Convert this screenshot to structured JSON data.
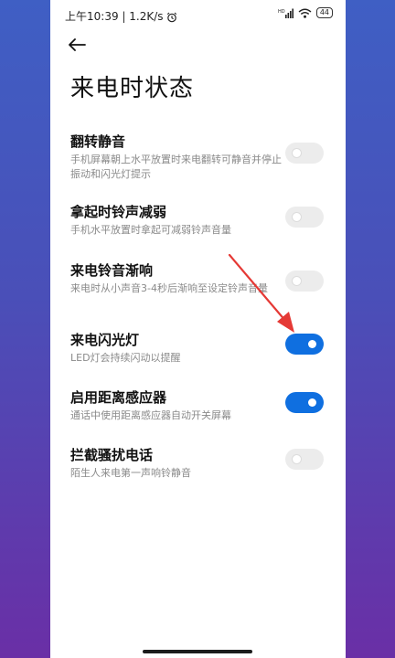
{
  "status_bar": {
    "time_speed": "上午10:39 | 1.2K/s",
    "signal_label": "HD",
    "battery": "44"
  },
  "page": {
    "title": "来电时状态"
  },
  "settings": [
    {
      "title": "翻转静音",
      "desc": "手机屏幕朝上水平放置时来电翻转可静音并停止振动和闪光灯提示",
      "enabled": false
    },
    {
      "title": "拿起时铃声减弱",
      "desc": "手机水平放置时拿起可减弱铃声音量",
      "enabled": false
    },
    {
      "title": "来电铃音渐响",
      "desc": "来电时从小声音3-4秒后渐响至设定铃声音量",
      "enabled": false
    },
    {
      "title": "来电闪光灯",
      "desc": "LED灯会持续闪动以提醒",
      "enabled": true
    },
    {
      "title": "启用距离感应器",
      "desc": "通话中使用距离感应器自动开关屏幕",
      "enabled": true
    },
    {
      "title": "拦截骚扰电话",
      "desc": "陌生人来电第一声响铃静音",
      "enabled": false
    }
  ],
  "colors": {
    "accent": "#0f6fe0",
    "annotation_arrow": "#e53935"
  }
}
